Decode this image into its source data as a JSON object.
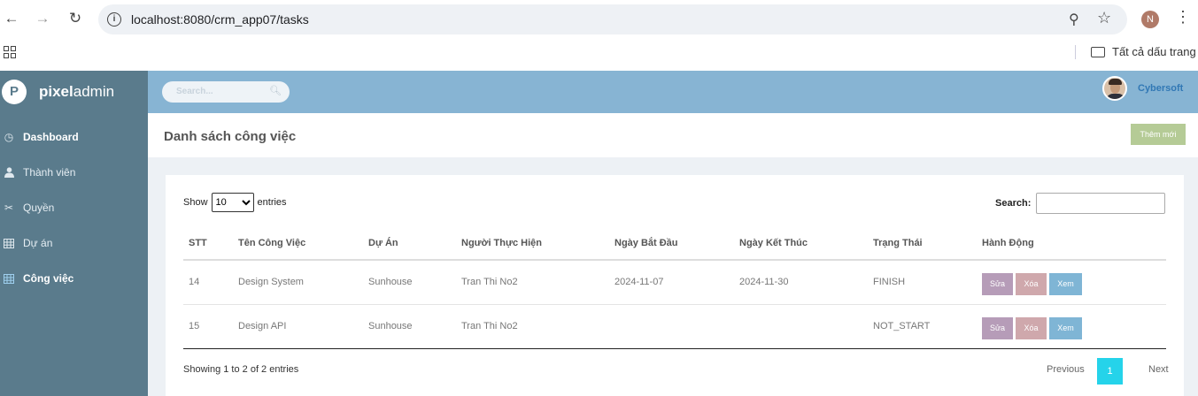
{
  "browser": {
    "url": "localhost:8080/crm_app07/tasks",
    "profile_initial": "N",
    "bookmarks_label": "Tất cả dấu trang"
  },
  "brand": {
    "logo_letter": "P",
    "name_bold": "pixel",
    "name_rest": "admin"
  },
  "topbar": {
    "search_placeholder": "Search...",
    "user_name": "Cybersoft"
  },
  "sidebar": {
    "items": [
      {
        "label": "Dashboard",
        "icon": "clock-icon",
        "active": true
      },
      {
        "label": "Thành viên",
        "icon": "user-icon",
        "active": false
      },
      {
        "label": "Quyền",
        "icon": "key-icon",
        "active": false
      },
      {
        "label": "Dự án",
        "icon": "table-icon",
        "active": false
      },
      {
        "label": "Công việc",
        "icon": "table-icon",
        "active": true
      }
    ]
  },
  "page": {
    "title": "Danh sách công việc",
    "add_label": "Thêm mới"
  },
  "table_controls": {
    "show_label": "Show",
    "entries_label": "entries",
    "page_size": "10",
    "search_label": "Search:"
  },
  "table": {
    "columns": [
      "STT",
      "Tên Công Việc",
      "Dự Án",
      "Người Thực Hiện",
      "Ngày Bắt Đầu",
      "Ngày Kết Thúc",
      "Trạng Thái",
      "Hành Động"
    ],
    "rows": [
      {
        "stt": "14",
        "name": "Design System",
        "project": "Sunhouse",
        "assignee": "Tran Thi No2",
        "start": "2024-11-07",
        "end": "2024-11-30",
        "status": "FINISH"
      },
      {
        "stt": "15",
        "name": "Design API",
        "project": "Sunhouse",
        "assignee": "Tran Thi No2",
        "start": "",
        "end": "",
        "status": "NOT_START"
      }
    ],
    "actions": {
      "edit": "Sửa",
      "delete": "Xóa",
      "view": "Xem"
    }
  },
  "footer": {
    "info": "Showing 1 to 2 of 2 entries",
    "prev": "Previous",
    "current_page": "1",
    "next": "Next"
  },
  "colors": {
    "sidebar": "#5a7b8c",
    "topbar": "#87b4d3",
    "add_button": "#b5cb96",
    "page_active": "#25d3ea"
  }
}
